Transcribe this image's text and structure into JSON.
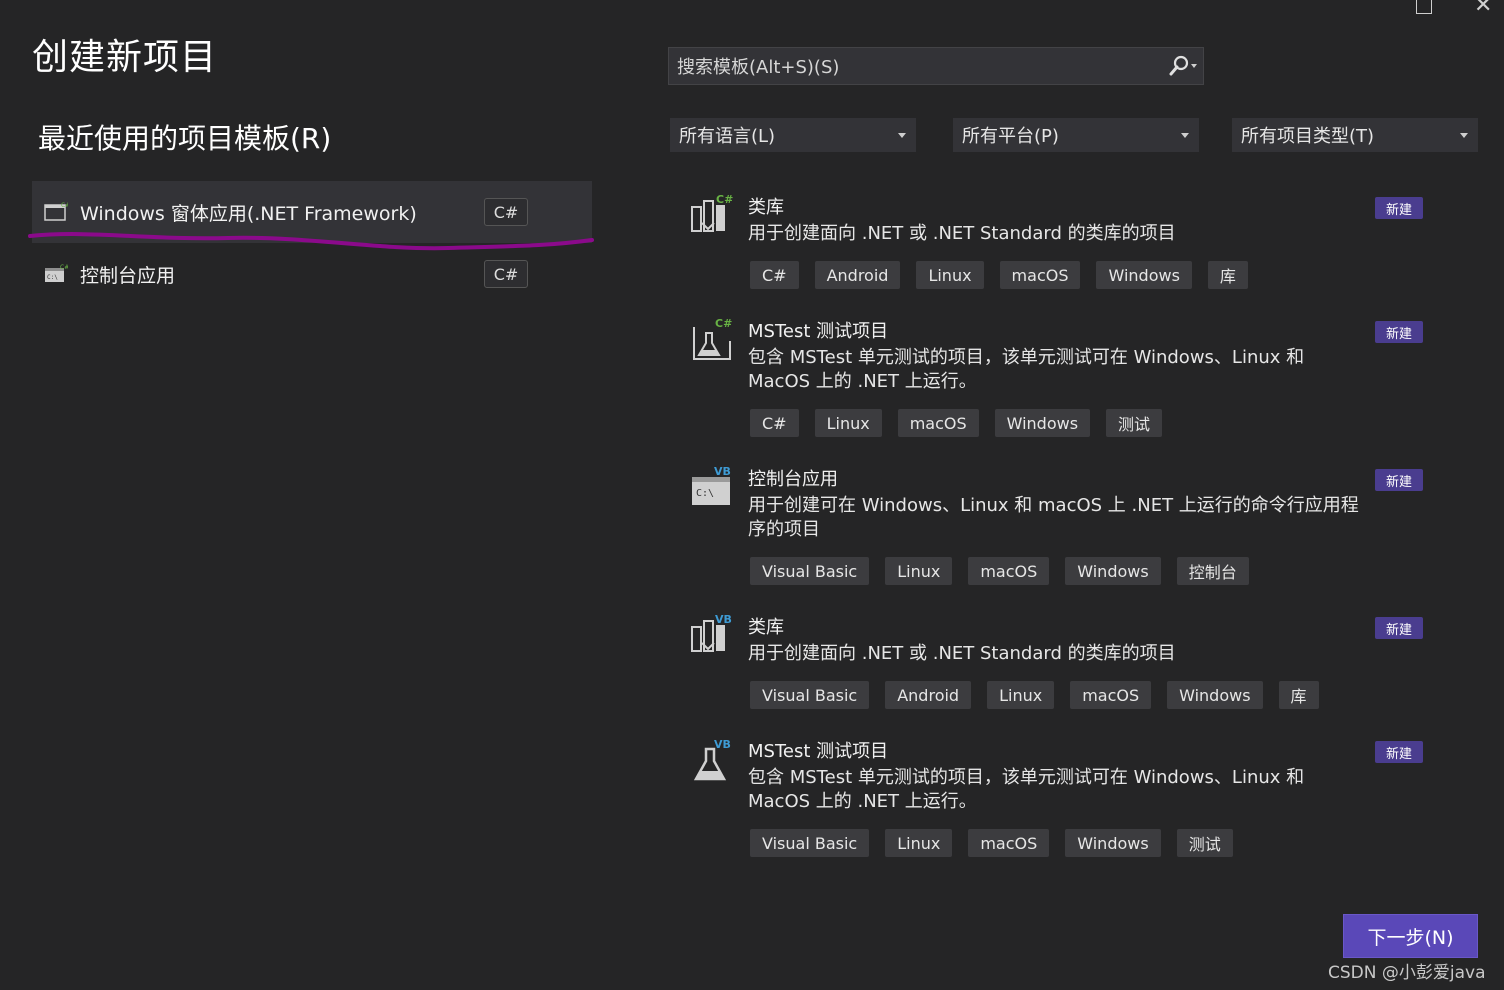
{
  "page": {
    "title": "创建新项目",
    "recent_title": "最近使用的项目模板(R)"
  },
  "recent": [
    {
      "label": "Windows 窗体应用(.NET Framework)",
      "lang": "C#",
      "selected": true
    },
    {
      "label": "控制台应用",
      "lang": "C#",
      "selected": false
    }
  ],
  "search": {
    "placeholder": "搜索模板(Alt+S)(S)"
  },
  "filters": [
    {
      "label": "所有语言(L)"
    },
    {
      "label": "所有平台(P)"
    },
    {
      "label": "所有项目类型(T)"
    }
  ],
  "templates": [
    {
      "name": "类库",
      "icon": "class-library-cs-icon",
      "badge": "C#",
      "desc": "用于创建面向 .NET 或 .NET Standard 的类库的项目",
      "new": "新建",
      "tags": [
        "C#",
        "Android",
        "Linux",
        "macOS",
        "Windows",
        "库"
      ]
    },
    {
      "name": "MSTest 测试项目",
      "icon": "mstest-cs-icon",
      "badge": "C#",
      "desc": "包含 MSTest 单元测试的项目，该单元测试可在 Windows、Linux 和 MacOS 上的 .NET 上运行。",
      "new": "新建",
      "tags": [
        "C#",
        "Linux",
        "macOS",
        "Windows",
        "测试"
      ]
    },
    {
      "name": "控制台应用",
      "icon": "console-vb-icon",
      "badge": "VB",
      "desc": "用于创建可在 Windows、Linux 和 macOS 上 .NET 上运行的命令行应用程序的项目",
      "new": "新建",
      "tags": [
        "Visual Basic",
        "Linux",
        "macOS",
        "Windows",
        "控制台"
      ]
    },
    {
      "name": "类库",
      "icon": "class-library-vb-icon",
      "badge": "VB",
      "desc": "用于创建面向 .NET 或 .NET Standard 的类库的项目",
      "new": "新建",
      "tags": [
        "Visual Basic",
        "Android",
        "Linux",
        "macOS",
        "Windows",
        "库"
      ]
    },
    {
      "name": "MSTest 测试项目",
      "icon": "mstest-vb-icon",
      "badge": "VB",
      "desc": "包含 MSTest 单元测试的项目，该单元测试可在 Windows、Linux 和 MacOS 上的 .NET 上运行。",
      "new": "新建",
      "tags": [
        "Visual Basic",
        "Linux",
        "macOS",
        "Windows",
        "测试"
      ]
    }
  ],
  "next_button": "下一步(N)",
  "watermark": "CSDN @小彭爱java",
  "colors": {
    "accent": "#5a48b8",
    "badge_new": "#4a3d8f",
    "highlight_mark": "#8b0a8b",
    "cs_badge": "#68b244",
    "vb_badge": "#3e9bd4"
  }
}
